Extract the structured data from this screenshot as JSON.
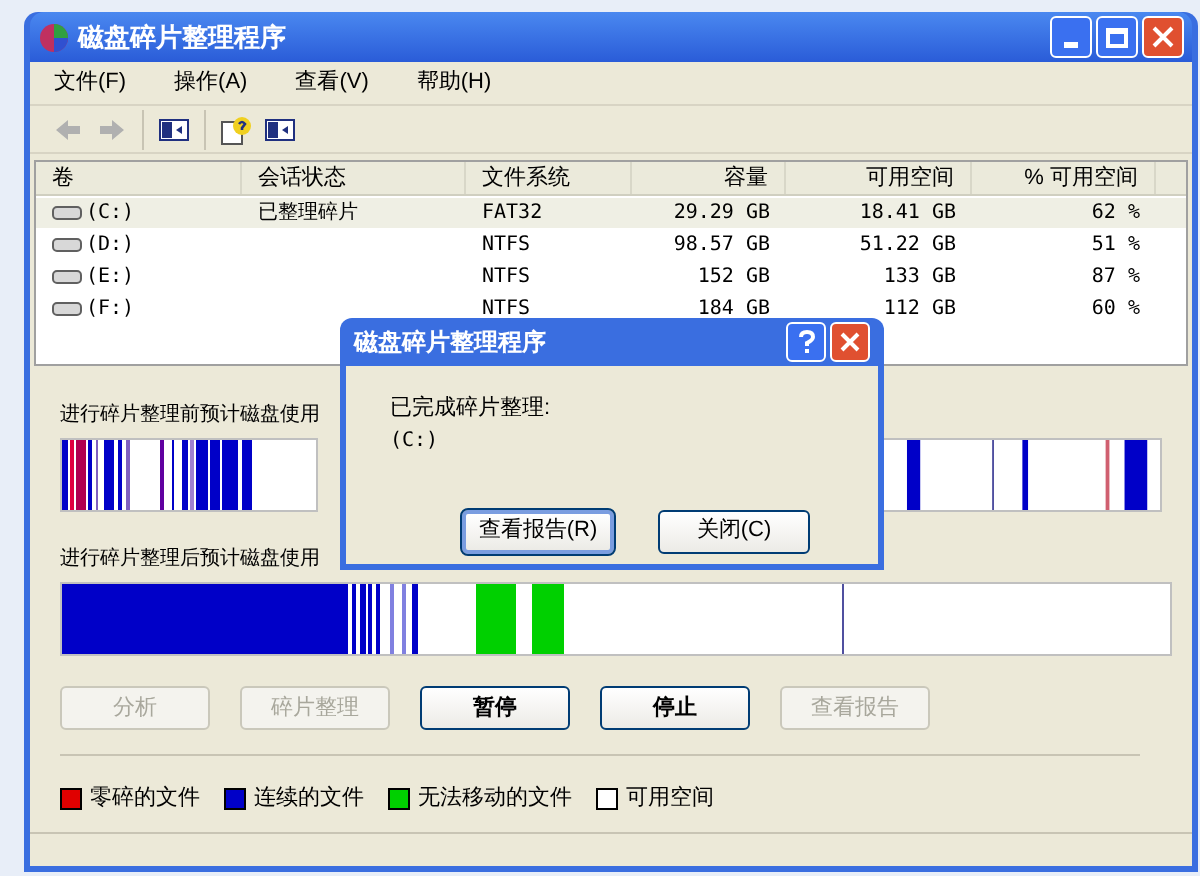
{
  "window": {
    "title": "磁盘碎片整理程序"
  },
  "menu": [
    {
      "label": "文件(F)"
    },
    {
      "label": "操作(A)"
    },
    {
      "label": "查看(V)"
    },
    {
      "label": "帮助(H)"
    }
  ],
  "toolbar": [
    {
      "kind": "back",
      "disabled": true
    },
    {
      "kind": "forward",
      "disabled": true
    },
    {
      "kind": "sep"
    },
    {
      "kind": "console",
      "disabled": false
    },
    {
      "kind": "sep"
    },
    {
      "kind": "help",
      "disabled": false
    },
    {
      "kind": "panel",
      "disabled": false
    }
  ],
  "table": {
    "columns": [
      "卷",
      "会话状态",
      "文件系统",
      "容量",
      "可用空间",
      "% 可用空间"
    ],
    "rows": [
      {
        "cells": [
          "(C:)",
          "已整理碎片",
          "FAT32",
          "29.29 GB",
          "18.41 GB",
          "62 %"
        ],
        "selected": true
      },
      {
        "cells": [
          "(D:)",
          "",
          "NTFS",
          "98.57 GB",
          "51.22 GB",
          "51 %"
        ],
        "selected": false
      },
      {
        "cells": [
          "(E:)",
          "",
          "NTFS",
          "152 GB",
          "133 GB",
          "87 %"
        ],
        "selected": false
      },
      {
        "cells": [
          "(F:)",
          "",
          "NTFS",
          "184 GB",
          "112 GB",
          "60 %"
        ],
        "selected": false
      }
    ]
  },
  "before_label": "进行碎片整理前预计磁盘使用",
  "after_label": "进行碎片整理后预计磁盘使用",
  "buttons": [
    {
      "label": "分析",
      "disabled": true
    },
    {
      "label": "碎片整理",
      "disabled": true
    },
    {
      "label": "暂停",
      "disabled": false
    },
    {
      "label": "停止",
      "disabled": false
    },
    {
      "label": "查看报告",
      "disabled": true
    }
  ],
  "legend": [
    {
      "label": "零碎的文件",
      "color": "#e00000"
    },
    {
      "label": "连续的文件",
      "color": "#0000c8"
    },
    {
      "label": "无法移动的文件",
      "color": "#00d000"
    },
    {
      "label": "可用空间",
      "color": "#ffffff"
    }
  ],
  "dialog": {
    "title": "磁盘碎片整理程序",
    "message": "已完成碎片整理:",
    "volume": "(C:)",
    "buttons": [
      {
        "label": "查看报告(R)",
        "selected": true
      },
      {
        "label": "关闭(C)",
        "selected": false
      }
    ]
  }
}
